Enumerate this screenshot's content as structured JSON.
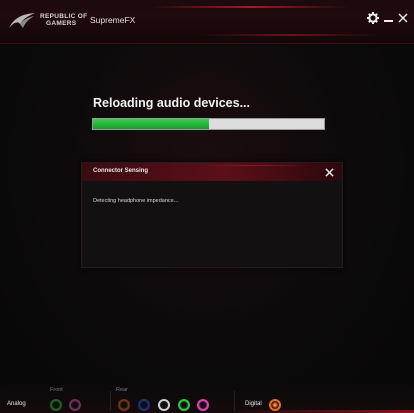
{
  "titlebar": {
    "brand_line1": "REPUBLIC OF",
    "brand_line2": "GAMERS",
    "app_title": "SupremeFX",
    "settings_icon": "gear-icon",
    "minimize_icon": "minimize-icon",
    "close_icon": "close-icon"
  },
  "loading": {
    "title": "Reloading audio devices...",
    "progress_percent": 50
  },
  "dialog": {
    "title": "Connector Sensing",
    "message": "Detecting headphone impedance..."
  },
  "jacks": {
    "analog_label": "Analog",
    "front_label": "Front",
    "rear_label": "Rear",
    "digital_label": "Digital",
    "front": [
      {
        "name": "green",
        "color": "#2fa33a"
      },
      {
        "name": "pink",
        "color": "#c04a9a"
      }
    ],
    "rear": [
      {
        "name": "orange",
        "color": "#c0581a"
      },
      {
        "name": "blue",
        "color": "#2050c8"
      },
      {
        "name": "black",
        "color": "#1a1a1a"
      },
      {
        "name": "green",
        "color": "#35c040"
      },
      {
        "name": "pink",
        "color": "#e040b0"
      }
    ],
    "digital": {
      "name": "spdif",
      "color": "#e07020"
    }
  },
  "colors": {
    "accent": "#b0141e",
    "progress": "#2ec043"
  }
}
